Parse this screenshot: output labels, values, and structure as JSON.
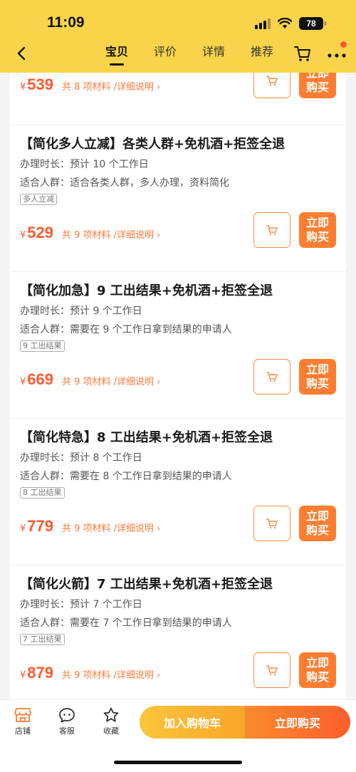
{
  "status": {
    "time": "11:09",
    "battery": "78"
  },
  "nav": {
    "tabs": [
      {
        "label": "宝贝",
        "active": true
      },
      {
        "label": "评价",
        "active": false
      },
      {
        "label": "详情",
        "active": false
      },
      {
        "label": "推荐",
        "active": false
      }
    ]
  },
  "colors": {
    "header": "#f9d44a",
    "accent": "#ff5a2c",
    "buy": "#ff7d30"
  },
  "packages": [
    {
      "title": "",
      "duration": "",
      "audience": "",
      "tag": "",
      "yen": "¥",
      "price": "539",
      "materials": "共 8 项材料 /详细说明",
      "chevron": "›",
      "buy_label": "立即购买"
    },
    {
      "title": "【简化多人立减】各类人群+免机酒+拒签全退",
      "duration": "办理时长：预计 10 个工作日",
      "audience": "适合人群：适合各类人群，多人办理，资料简化",
      "tag": "多人立减",
      "yen": "¥",
      "price": "529",
      "materials": "共 9 项材料 /详细说明",
      "chevron": "›",
      "buy_label": "立即购买"
    },
    {
      "title": "【简化加急】9 工出结果+免机酒+拒签全退",
      "duration": "办理时长：预计 9 个工作日",
      "audience": "适合人群：需要在 9 个工作日拿到结果的申请人",
      "tag": "9 工出结果",
      "yen": "¥",
      "price": "669",
      "materials": "共 9 项材料 /详细说明",
      "chevron": "›",
      "buy_label": "立即购买"
    },
    {
      "title": "【简化特急】8 工出结果+免机酒+拒签全退",
      "duration": "办理时长：预计 8 个工作日",
      "audience": "适合人群：需要在 8 个工作日拿到结果的申请人",
      "tag": "8 工出结果",
      "yen": "¥",
      "price": "779",
      "materials": "共 9 项材料 /详细说明",
      "chevron": "›",
      "buy_label": "立即购买"
    },
    {
      "title": "【简化火箭】7 工出结果+免机酒+拒签全退",
      "duration": "办理时长：预计 7 个工作日",
      "audience": "适合人群：需要在 7 个工作日拿到结果的申请人",
      "tag": "7 工出结果",
      "yen": "¥",
      "price": "879",
      "materials": "共 9 项材料 /详细说明",
      "chevron": "›",
      "buy_label": "立即购买"
    }
  ],
  "bottom": {
    "store": "店铺",
    "service": "客服",
    "favorite": "收藏",
    "add_cart": "加入购物车",
    "buy_now": "立即购买"
  }
}
